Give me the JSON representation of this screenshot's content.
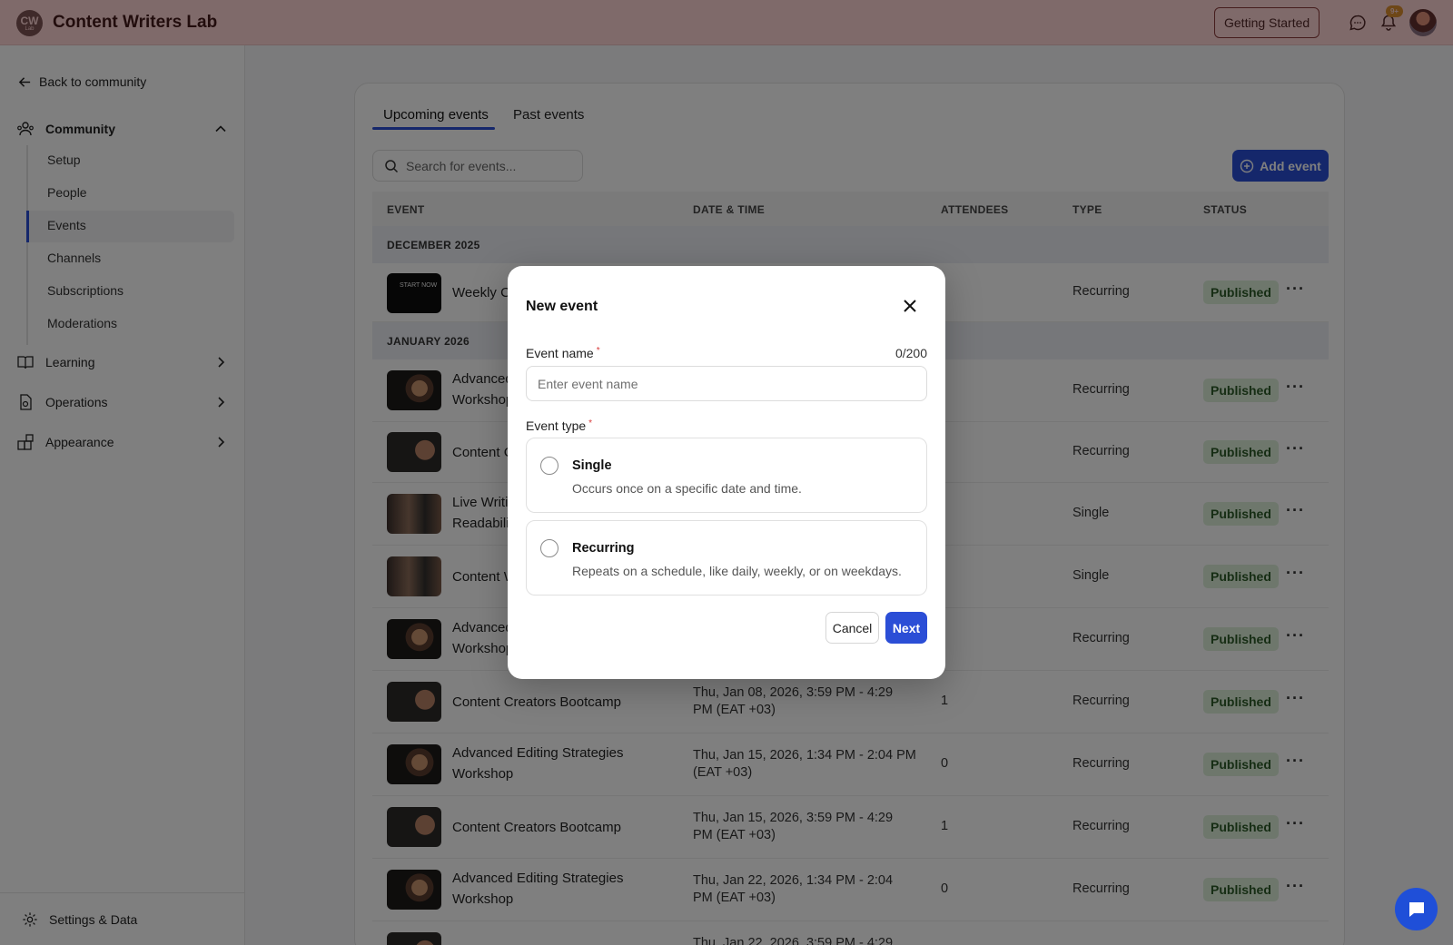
{
  "app": {
    "logo_initials": "CW",
    "logo_sub": "Lab",
    "title": "Content Writers Lab",
    "getting_started": "Getting Started",
    "notifications_badge": "9+"
  },
  "sidebar": {
    "back": "Back to community",
    "community": "Community",
    "sub_items": [
      "Setup",
      "People",
      "Events",
      "Channels",
      "Subscriptions",
      "Moderations"
    ],
    "active_item": "Events",
    "learning": "Learning",
    "operations": "Operations",
    "appearance": "Appearance",
    "footer": "Settings & Data"
  },
  "main": {
    "tabs": [
      "Upcoming events",
      "Past events"
    ],
    "active_tab": "Upcoming events",
    "search_placeholder": "Search for events...",
    "add_event": "Add event",
    "columns": [
      "EVENT",
      "DATE & TIME",
      "ATTENDEES",
      "TYPE",
      "STATUS"
    ],
    "months": [
      "DECEMBER 2025",
      "JANUARY 2026"
    ],
    "rows": [
      {
        "name": "Weekly C",
        "name2": "",
        "date": "",
        "date2": "",
        "attendees": "",
        "type": "Recurring",
        "status": "Published",
        "thumb_text": "START NOW"
      },
      {
        "name": "Advanced",
        "name2": "Workshop",
        "date": "",
        "date2": "",
        "attendees": "",
        "type": "Recurring",
        "status": "Published",
        "thumb_text": ""
      },
      {
        "name": "Content C",
        "name2": "",
        "date": "",
        "date2": "",
        "attendees": "",
        "type": "Recurring",
        "status": "Published",
        "thumb_text": ""
      },
      {
        "name": "Live Writin",
        "name2": "Readabilit",
        "date": "",
        "date2": "",
        "attendees": "",
        "type": "Single",
        "status": "Published",
        "thumb_text": ""
      },
      {
        "name": "Content W",
        "name2": "",
        "date": "",
        "date2": "",
        "attendees": "",
        "type": "Single",
        "status": "Published",
        "thumb_text": ""
      },
      {
        "name": "Advanced",
        "name2": "Workshop",
        "date": "",
        "date2": "",
        "attendees": "",
        "type": "Recurring",
        "status": "Published",
        "thumb_text": ""
      },
      {
        "name": "Content Creators Bootcamp",
        "name2": "",
        "date": "Thu, Jan 08, 2026, 3:59 PM - 4:29",
        "date2": "PM (EAT +03)",
        "attendees": "1",
        "type": "Recurring",
        "status": "Published",
        "thumb_text": ""
      },
      {
        "name": "Advanced Editing Strategies",
        "name2": "Workshop",
        "date": "Thu, Jan 15, 2026, 1:34 PM - 2:04 PM",
        "date2": "(EAT +03)",
        "attendees": "0",
        "type": "Recurring",
        "status": "Published",
        "thumb_text": ""
      },
      {
        "name": "Content Creators Bootcamp",
        "name2": "",
        "date": "Thu, Jan 15, 2026, 3:59 PM - 4:29",
        "date2": "PM (EAT +03)",
        "attendees": "1",
        "type": "Recurring",
        "status": "Published",
        "thumb_text": ""
      },
      {
        "name": "Advanced Editing Strategies",
        "name2": "Workshop",
        "date": "Thu, Jan 22, 2026, 1:34 PM - 2:04",
        "date2": "PM (EAT +03)",
        "attendees": "0",
        "type": "Recurring",
        "status": "Published",
        "thumb_text": ""
      },
      {
        "name": "",
        "name2": "",
        "date": "Thu, Jan 22, 2026, 3:59 PM - 4:29",
        "date2": "",
        "attendees": "",
        "type": "",
        "status": "",
        "thumb_text": ""
      }
    ]
  },
  "modal": {
    "title": "New event",
    "event_name_label": "Event name",
    "char_count": "0/200",
    "event_name_placeholder": "Enter event name",
    "event_name_value": "",
    "event_type_label": "Event type",
    "options": [
      {
        "title": "Single",
        "desc": "Occurs once on a specific date and time."
      },
      {
        "title": "Recurring",
        "desc": "Repeats on a schedule, like daily, weekly, or on weekdays."
      }
    ],
    "cancel": "Cancel",
    "next": "Next"
  },
  "colors": {
    "accent": "#2b4ed6",
    "published_bg": "#dcefd9",
    "required": "#d83a3a"
  }
}
